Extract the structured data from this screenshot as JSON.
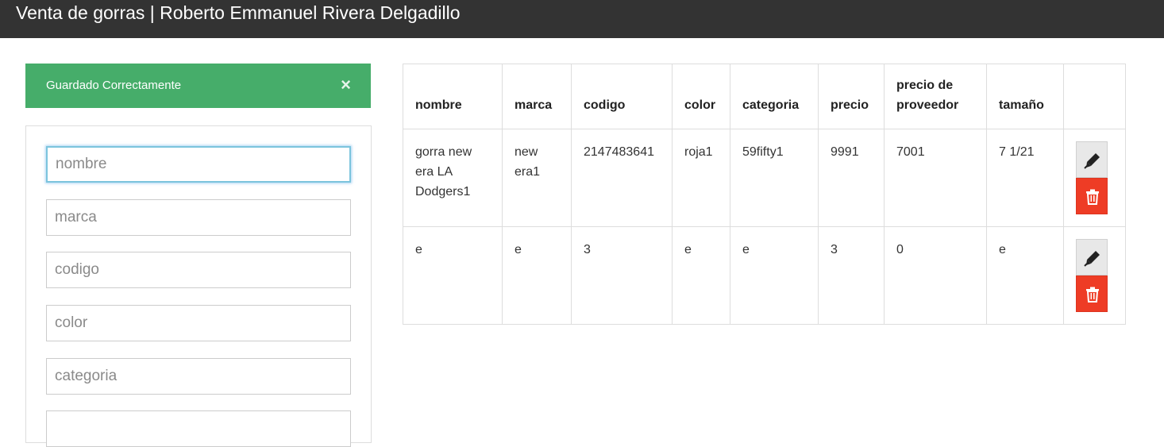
{
  "header": {
    "title": "Venta de gorras | Roberto Emmanuel Rivera Delgadillo"
  },
  "alert": {
    "message": "Guardado Correctamente",
    "close_symbol": "×",
    "color": "#46ad6a"
  },
  "form": {
    "fields": [
      {
        "placeholder": "nombre",
        "value": ""
      },
      {
        "placeholder": "marca",
        "value": ""
      },
      {
        "placeholder": "codigo",
        "value": ""
      },
      {
        "placeholder": "color",
        "value": ""
      },
      {
        "placeholder": "categoria",
        "value": ""
      },
      {
        "placeholder": "",
        "value": ""
      }
    ]
  },
  "table": {
    "columns": [
      "nombre",
      "marca",
      "codigo",
      "color",
      "categoria",
      "precio",
      "precio de proveedor",
      "tamaño",
      ""
    ],
    "rows": [
      [
        "gorra new era LA Dodgers1",
        "new era1",
        "2147483641",
        "roja1",
        "59fifty1",
        "9991",
        "7001",
        "7 1/21"
      ],
      [
        "e",
        "e",
        "3",
        "e",
        "e",
        "3",
        "0",
        "e"
      ]
    ],
    "edit_icon": "pencil-icon",
    "delete_icon": "trash-icon",
    "delete_color": "#ee3c25"
  }
}
